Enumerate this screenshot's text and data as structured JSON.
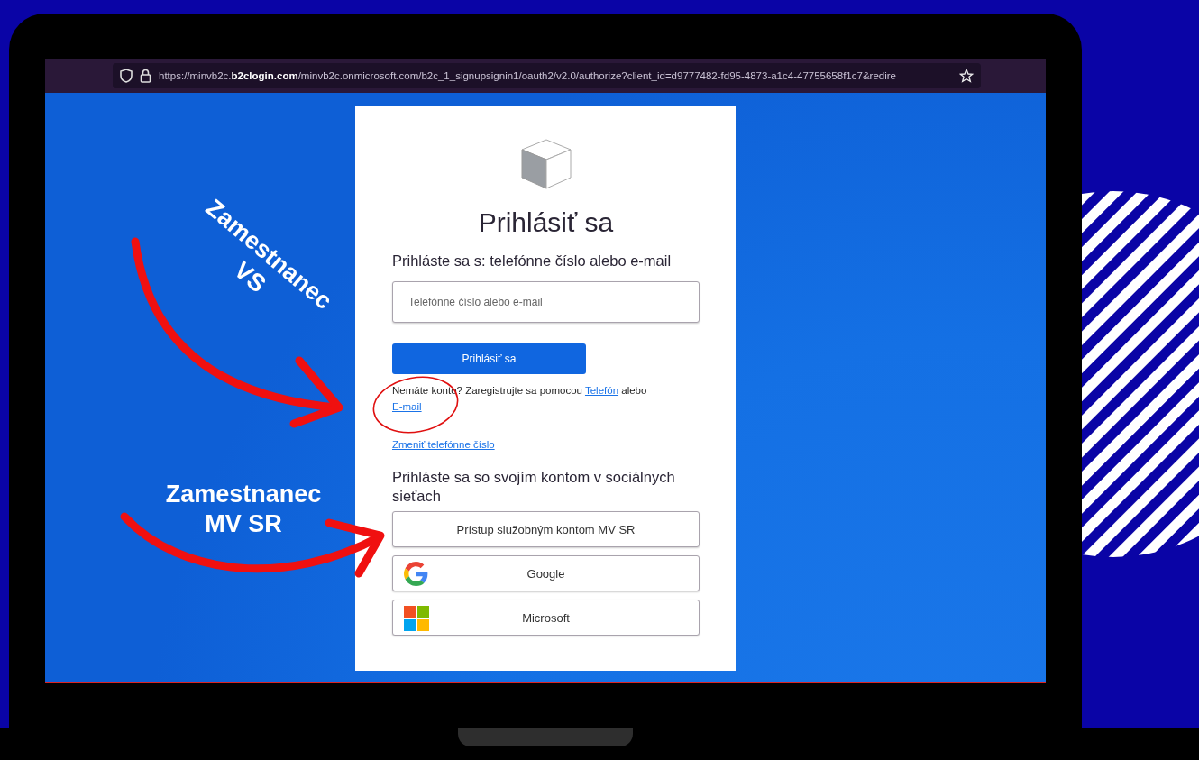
{
  "browser": {
    "url": "https://minvb2c.**b2clogin.com**/minvb2c.onmicrosoft.com/b2c_1_signupsignin1/oauth2/v2.0/authorize?client_id=d9777482-fd95-4873-a1c4-47755658f1c7&redire"
  },
  "login": {
    "title": "Prihlásiť sa",
    "subtitle": "Prihláste sa s: telefónne číslo alebo e-mail",
    "input": {
      "placeholder": "Telefónne číslo alebo e-mail"
    },
    "submit": "Prihlásiť sa",
    "signup": {
      "text": "Nemáte konto? Zaregistrujte sa pomocou",
      "phone_link": "Telefón",
      "joiner": "alebo",
      "email_link": "E-mail"
    },
    "change_link": "Zmeniť telefónne číslo",
    "social_heading": "Prihláste sa so svojím kontom v sociálnych sieťach",
    "social_buttons": [
      {
        "kind": "plain",
        "label": "Prístup služobným kontom MV SR"
      },
      {
        "kind": "google",
        "label": "Google"
      },
      {
        "kind": "microsoft",
        "label": "Microsoft"
      }
    ]
  },
  "annotations": [
    {
      "kind": "diagonal",
      "text": "Zamestnanec VS"
    },
    {
      "kind": "flat",
      "text": "Zamestnanec MV SR"
    }
  ]
}
